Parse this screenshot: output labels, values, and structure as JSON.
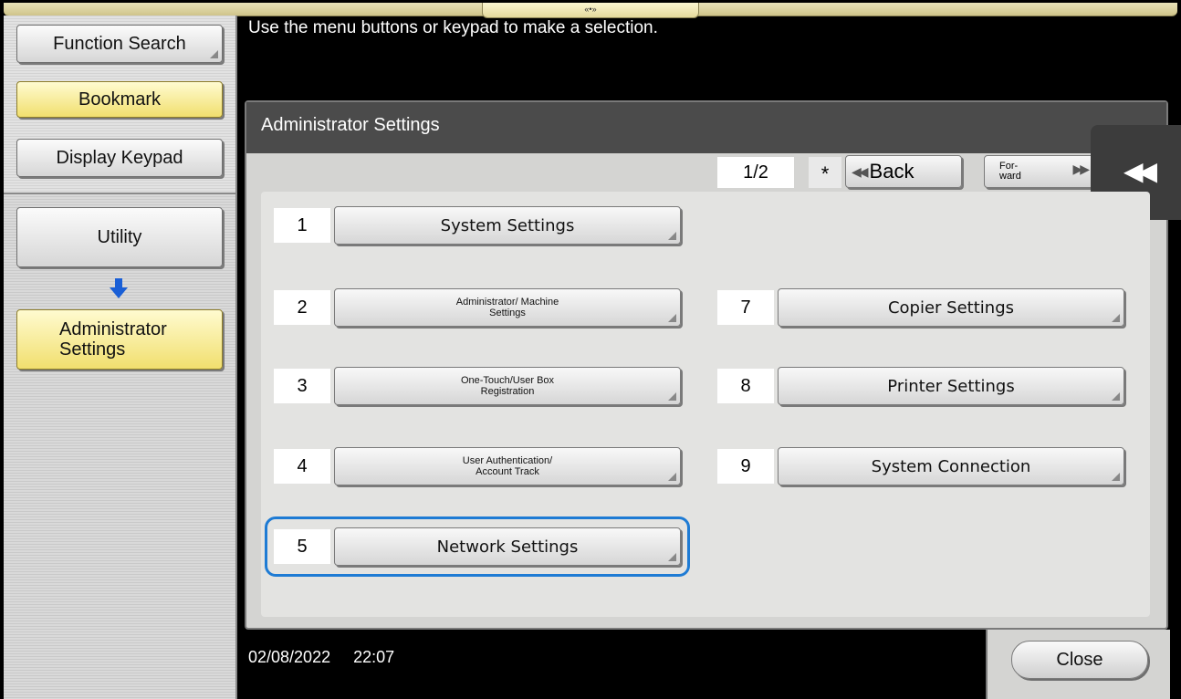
{
  "header": {
    "handle_glyph": "«•»"
  },
  "left_panel": {
    "function_search": "Function Search",
    "bookmark": "Bookmark",
    "display_keypad": "Display Keypad",
    "breadcrumb_utility": "Utility",
    "breadcrumb_admin": "Administrator Settings"
  },
  "message": "Use the menu buttons or keypad to make a selection.",
  "window": {
    "title": "Administrator Settings",
    "pager": "1/2",
    "star": "*",
    "back_label": "Back",
    "forward_label": "For- ward"
  },
  "menu_items": [
    {
      "num": "1",
      "label": "System Settings"
    },
    {
      "num": "2",
      "label": "Administrator/ Machine Settings"
    },
    {
      "num": "3",
      "label": "One-Touch/User Box Registration"
    },
    {
      "num": "4",
      "label": "User Authentication/ Account Track"
    },
    {
      "num": "5",
      "label": "Network Settings"
    },
    {
      "num": "7",
      "label": "Copier Settings"
    },
    {
      "num": "8",
      "label": "Printer Settings"
    },
    {
      "num": "9",
      "label": "System Connection"
    }
  ],
  "footer": {
    "date": "02/08/2022",
    "time": "22:07",
    "close_label": "Close"
  },
  "colors": {
    "highlight": "#1e7bd4",
    "bookmark_yellow": "#f1df6e",
    "title_bar": "#4b4b4b"
  }
}
